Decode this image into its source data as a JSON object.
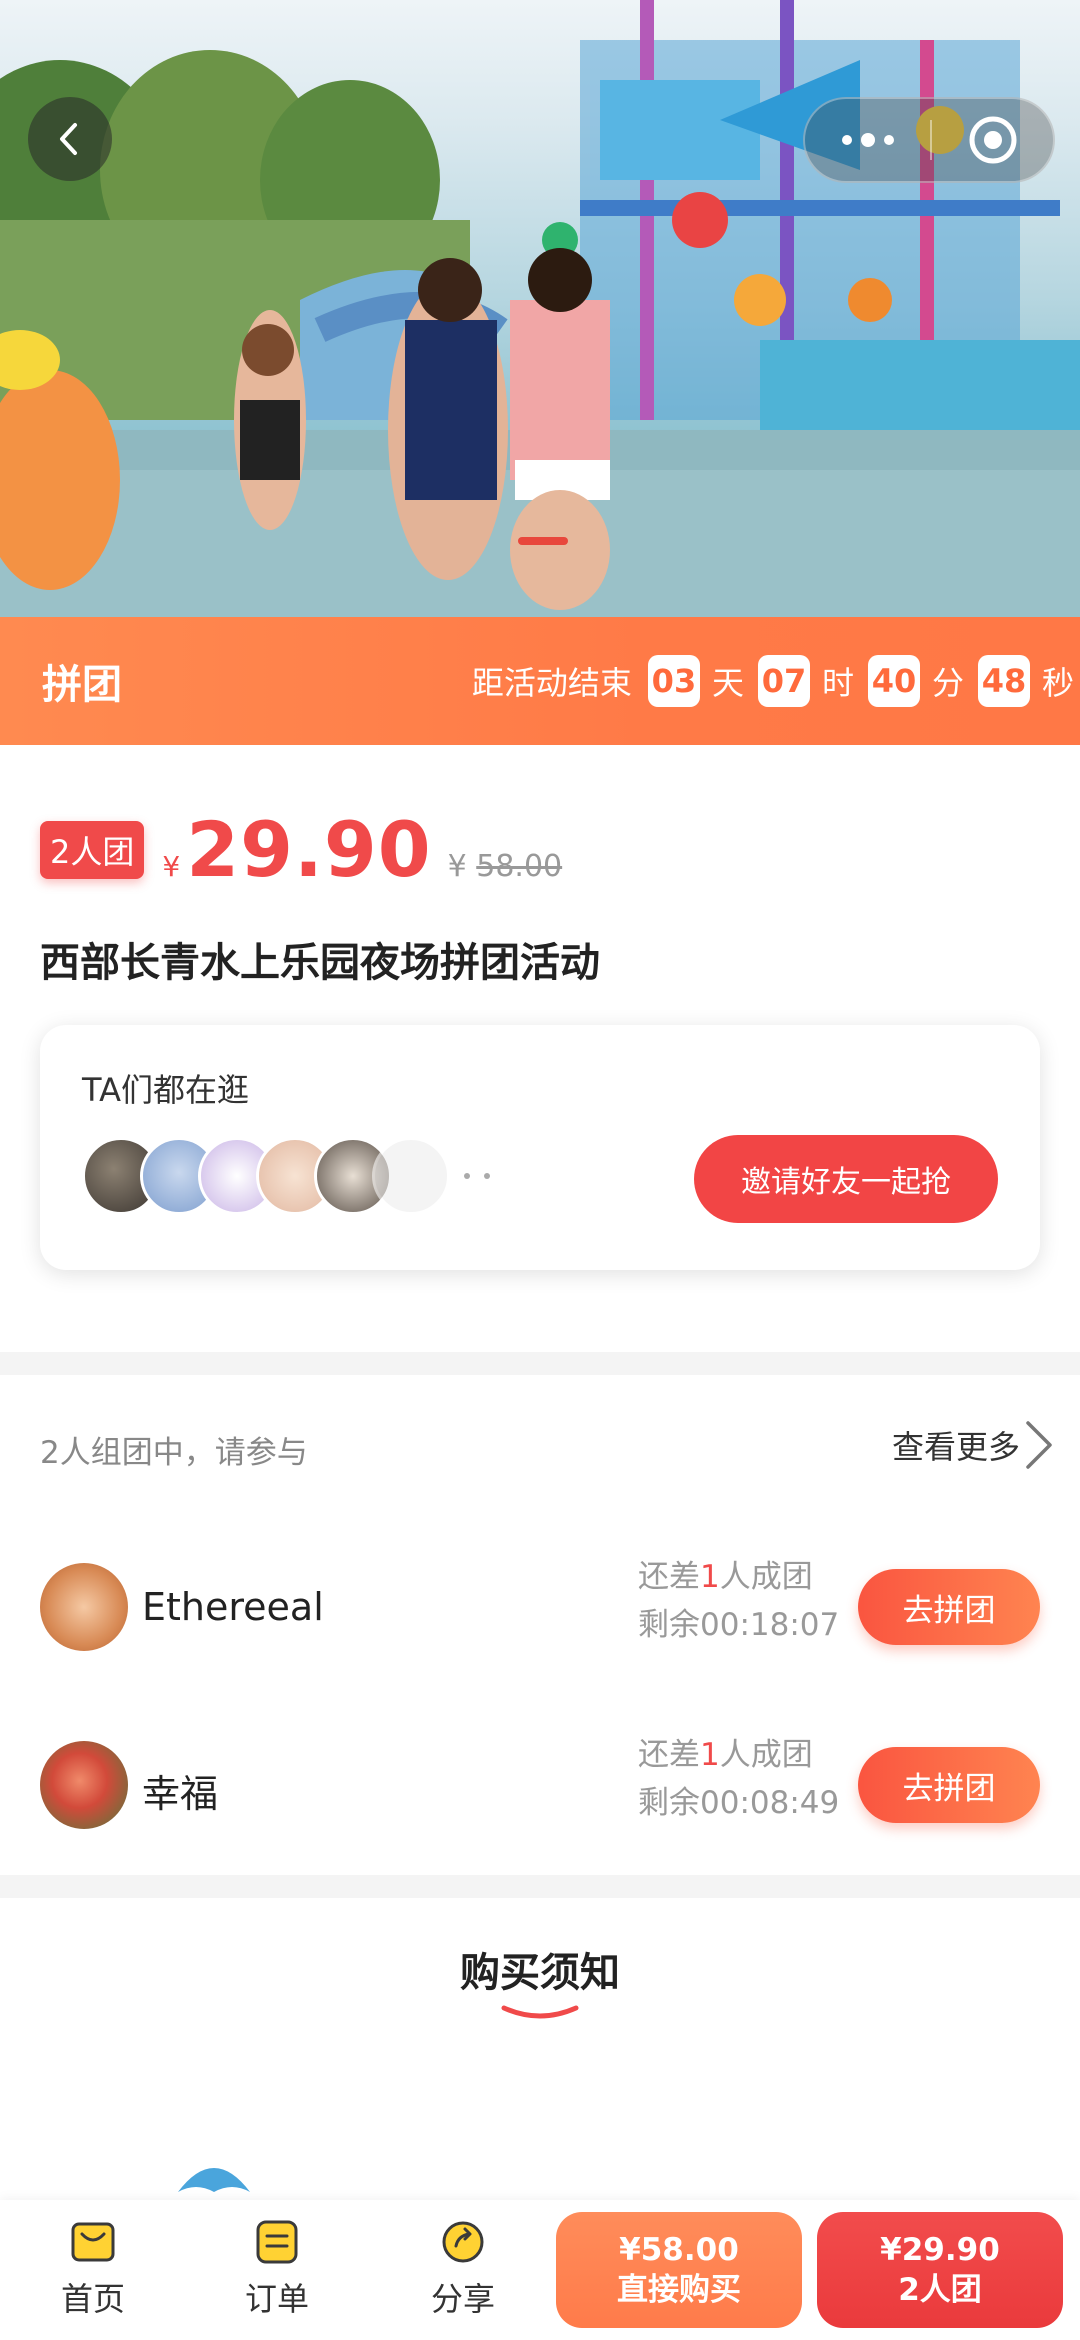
{
  "hero": {
    "back_icon": "chevron-left-icon",
    "menu_icon": "more-dots-icon",
    "close_icon": "target-circle-icon"
  },
  "group_bar": {
    "tag": "拼团",
    "countdown_lead": "距活动结束",
    "days": "03",
    "days_unit": "天",
    "hours": "07",
    "hours_unit": "时",
    "minutes": "40",
    "minutes_unit": "分",
    "seconds": "48",
    "seconds_unit": "秒"
  },
  "product": {
    "badge": "2人团",
    "currency": "¥",
    "price": "29.90",
    "original_currency": "¥",
    "original_price": "58.00",
    "title": "西部长青水上乐园夜场拼团活动"
  },
  "browse": {
    "label": "TA们都在逛",
    "invite_button": "邀请好友一起抢"
  },
  "groups": {
    "header_left": "2人组团中，请参与",
    "header_right": "查看更多",
    "rows": [
      {
        "name": "Ethereeal",
        "need_prefix": "还差",
        "need_count": "1",
        "need_suffix": "人成团",
        "remaining": "剩余00:18:07",
        "button": "去拼团"
      },
      {
        "name": "幸福",
        "need_prefix": "还差",
        "need_count": "1",
        "need_suffix": "人成团",
        "remaining": "剩余00:08:49",
        "button": "去拼团"
      }
    ]
  },
  "notice": {
    "heading": "购买须知"
  },
  "bottom_nav": {
    "home": "首页",
    "orders": "订单",
    "share": "分享",
    "direct_price": "¥58.00",
    "direct_label": "直接购买",
    "group_price": "¥29.90",
    "group_label": "2人团"
  },
  "colors": {
    "accent_red": "#f04a4a",
    "accent_orange": "#ff7a47",
    "icon_yellow": "#ffd233"
  }
}
